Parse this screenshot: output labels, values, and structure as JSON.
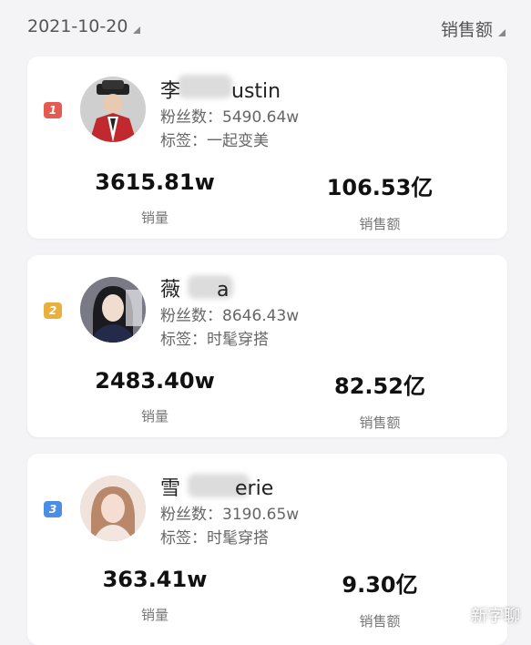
{
  "filters": {
    "date": "2021-10-20",
    "sort": "销售额"
  },
  "colors": {
    "rank1": "#e45b52",
    "rank2": "#eab03e",
    "rank3": "#4a8ee6"
  },
  "cards": [
    {
      "rank": "1",
      "name": "李佳琦Austin",
      "name_prefix": "李",
      "name_suffix": "ustin",
      "fans": "粉丝数：5490.64w",
      "tag": "标签：一起变美",
      "sales_volume": "3615.81w",
      "sales_volume_label": "销量",
      "sales_amount": "106.53亿",
      "sales_amount_label": "销售额"
    },
    {
      "rank": "2",
      "name_prefix": "薇",
      "name_suffix": "a",
      "fans": "粉丝数：8646.43w",
      "tag": "标签：时髦穿搭",
      "sales_volume": "2483.40w",
      "sales_volume_label": "销量",
      "sales_amount": "82.52亿",
      "sales_amount_label": "销售额"
    },
    {
      "rank": "3",
      "name_prefix": "雪",
      "name_suffix": "erie",
      "fans": "粉丝数：3190.65w",
      "tag": "标签：时髦穿搭",
      "sales_volume": "363.41w",
      "sales_volume_label": "销量",
      "sales_amount": "9.30亿",
      "sales_amount_label": "销售额"
    }
  ],
  "watermark": "新字聊"
}
